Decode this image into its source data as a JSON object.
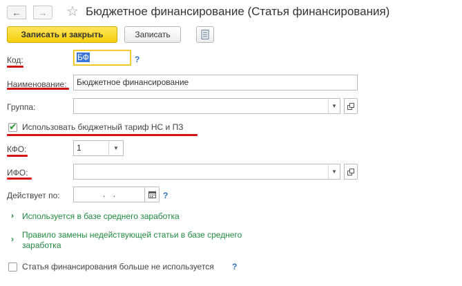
{
  "window": {
    "title": "Бюджетное финансирование (Статья финансирования)",
    "back_glyph": "←",
    "forward_glyph": "→",
    "star_glyph": "☆"
  },
  "toolbar": {
    "save_close_label": "Записать и закрыть",
    "save_label": "Записать",
    "report_icon": "document-list-icon"
  },
  "form": {
    "code": {
      "label": "Код:",
      "value": "БФ"
    },
    "name": {
      "label": "Наименование:",
      "value": "Бюджетное финансирование"
    },
    "group": {
      "label": "Группа:",
      "value": ""
    },
    "use_budget_tariff": {
      "label": "Использовать бюджетный тариф НС и ПЗ",
      "checked": true
    },
    "kfo": {
      "label": "КФО:",
      "value": "1"
    },
    "ifo": {
      "label": "ИФО:",
      "value": ""
    },
    "valid_until": {
      "label": "Действует по:",
      "value": ".  ."
    },
    "help_glyph": "?"
  },
  "links": {
    "average_earnings": "Используется в базе среднего заработка",
    "replacement_rule_line1": "Правило замены недействующей статьи в базе среднего",
    "replacement_rule_line2": "заработка"
  },
  "footer": {
    "not_used_label": "Статья финансирования больше не используется",
    "not_used_checked": false
  },
  "colors": {
    "accent_yellow": "#f5d009",
    "link_green": "#1f8a3e",
    "help_blue": "#2f73c9",
    "annotation_red": "#d31313"
  }
}
